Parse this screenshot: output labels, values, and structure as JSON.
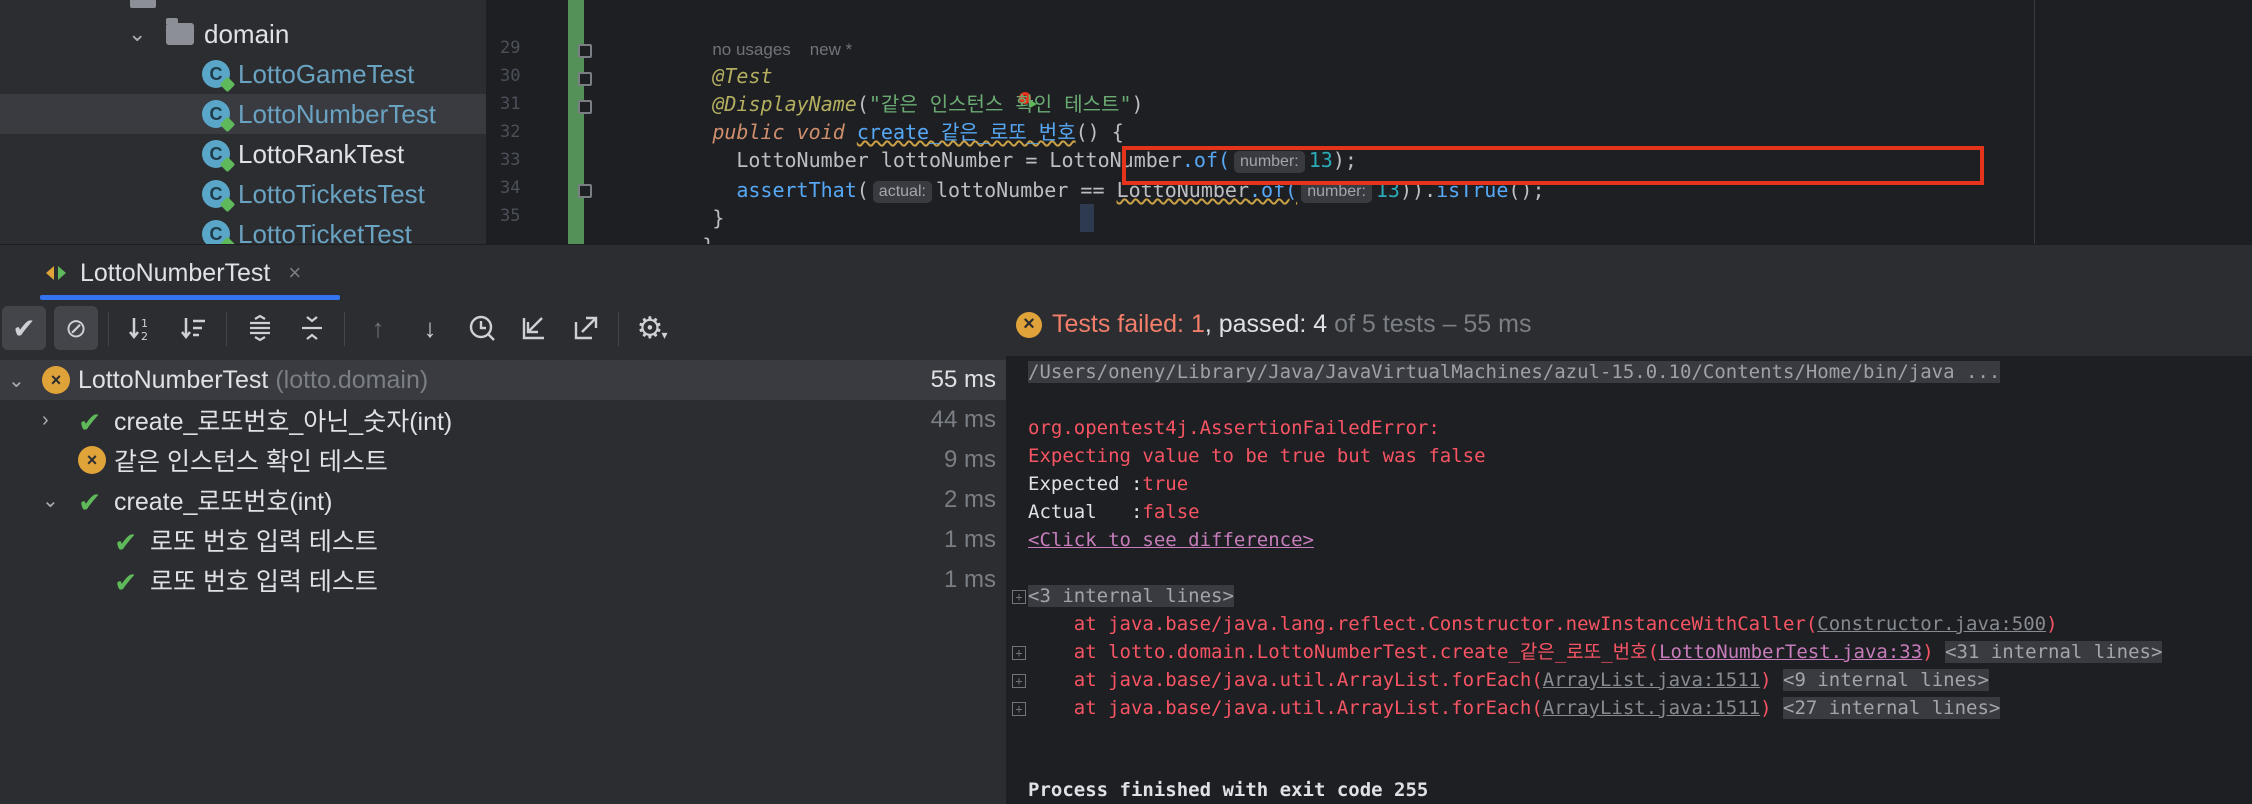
{
  "project_tree": {
    "folder_label": "domain",
    "items": [
      {
        "label": "LottoGameTest"
      },
      {
        "label": "LottoNumberTest"
      },
      {
        "label": "LottoRankTest"
      },
      {
        "label": "LottoTicketsTest"
      },
      {
        "label": "LottoTicketTest"
      }
    ]
  },
  "editor": {
    "usage_hint": "no usages",
    "new_hint": "new *",
    "line_numbers": [
      "29",
      "30",
      "31",
      "32",
      "33",
      "34",
      "35"
    ],
    "lines": {
      "annotation_test": "@Test",
      "display_name_annot": "@DisplayName",
      "display_name_str": "\"같은 인스턴스 확인 테스트\"",
      "method_kw": "public void ",
      "method_name": "create_같은_로또_번호",
      "method_tail": "() {",
      "line32_type": "LottoNumber",
      "line32_var": " lottoNumber = ",
      "line32_cls": "LottoNumber",
      "line32_of": ".of(",
      "hint_number": "number:",
      "num_13": "13",
      "line32_end": ");",
      "assert_fn": "assertThat",
      "paren_open": "(",
      "hint_actual": "actual:",
      "line33_mid": "lottoNumber == ",
      "line33_cls": "LottoNumber",
      "line33_of": ".of(",
      "line33_tail_a": ")).",
      "is_true": "isTrue",
      "line33_end": "();",
      "close_brace_1": "}",
      "close_brace_2": "}"
    }
  },
  "run_tab": {
    "label": "LottoNumberTest",
    "close": "×"
  },
  "status": {
    "failed_text": "Tests failed: 1",
    "passed_text": ", passed: 4",
    "of_text": "of 5 tests",
    "duration_text": "– 55 ms"
  },
  "test_tree": [
    {
      "name": "LottoNumberTest",
      "pkg": "(lotto.domain)",
      "duration": "55 ms",
      "status": "failed"
    },
    {
      "name": "create_로또번호_아닌_숫자(int)",
      "duration": "44 ms",
      "status": "passed"
    },
    {
      "name": "같은 인스턴스 확인 테스트",
      "duration": "9 ms",
      "status": "failed"
    },
    {
      "name": "create_로또번호(int)",
      "duration": "2 ms",
      "status": "passed"
    },
    {
      "name": "로또 번호 입력 테스트",
      "duration": "1 ms",
      "status": "passed"
    },
    {
      "name": "로또 번호 입력 테스트",
      "duration": "1 ms",
      "status": "passed"
    }
  ],
  "console": {
    "cmd": "/Users/oneny/Library/Java/JavaVirtualMachines/azul-15.0.10/Contents/Home/bin/java ...",
    "error_class": "org.opentest4j.AssertionFailedError:",
    "error_msg": "Expecting value to be true but was false",
    "expected_label": "Expected :",
    "expected_value": "true",
    "actual_label": "Actual   :",
    "actual_value": "false",
    "diff_link": "<Click to see difference>",
    "internal_3": "<3 internal lines>",
    "trace1_pre": "    at java.base/java.lang.reflect.Constructor.newInstanceWithCaller(",
    "trace1_link": "Constructor.java:500",
    "trace1_post": ")",
    "trace2_pre": "    at lotto.domain.LottoNumberTest.create_같은_로또_번호(",
    "trace2_link": "LottoNumberTest.java:33",
    "trace2_post": ")",
    "internal_31": "<31 internal lines>",
    "trace3_pre": "    at java.base/java.util.ArrayList.forEach(",
    "trace3_link": "ArrayList.java:1511",
    "trace3_post": ")",
    "internal_9": "<9 internal lines>",
    "trace4_pre": "    at java.base/java.util.ArrayList.forEach(",
    "trace4_link": "ArrayList.java:1511",
    "trace4_post": ")",
    "internal_27": "<27 internal lines>",
    "exit": "Process finished with exit code 255"
  },
  "colors": {
    "accent": "#3574f0",
    "pass": "#5fb85a",
    "fail": "#e0a33a",
    "error_text": "#f75464",
    "highlight_box": "#e5331c"
  }
}
